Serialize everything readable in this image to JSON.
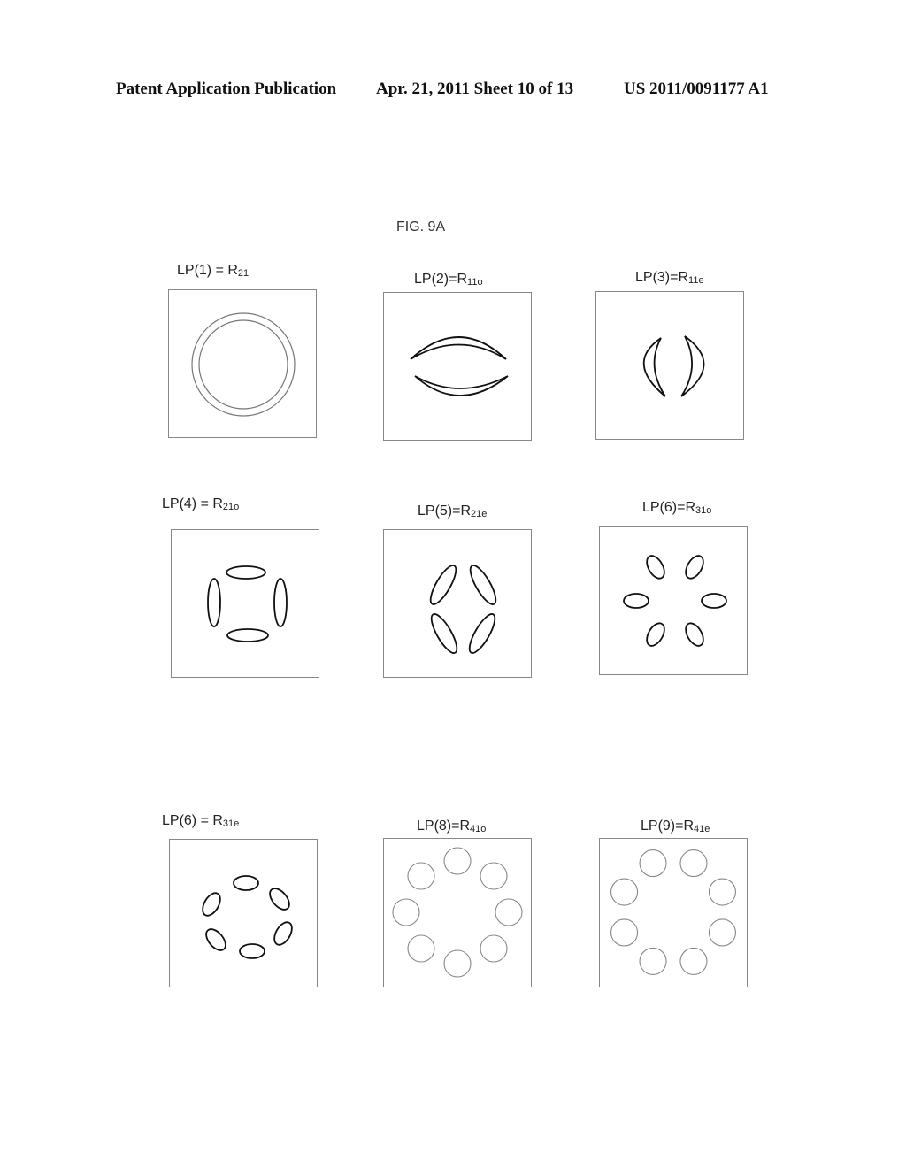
{
  "header": {
    "publication": "Patent Application Publication",
    "date_sheet": "Apr. 21, 2011  Sheet 10 of 13",
    "patent_number": "US 2011/0091177 A1"
  },
  "figure_title": "FIG. 9A",
  "panels": [
    {
      "label": "LP(1) = R",
      "sub": "21",
      "pattern": "concentric-rings"
    },
    {
      "label": "LP(2)=R",
      "sub": "11o",
      "pattern": "two-horizontal-crescents"
    },
    {
      "label": "LP(3)=R",
      "sub": "11e",
      "pattern": "two-vertical-crescents"
    },
    {
      "label": "LP(4) = R",
      "sub": "21o",
      "pattern": "four-ellipses-cross"
    },
    {
      "label": "LP(5)=R",
      "sub": "21e",
      "pattern": "four-ellipses-diagonal"
    },
    {
      "label": "LP(6)=R",
      "sub": "31o",
      "pattern": "six-ellipses-ring"
    },
    {
      "label": "LP(6) = R",
      "sub": "31e",
      "pattern": "six-ellipses-ring-rotated"
    },
    {
      "label": "LP(8)=R",
      "sub": "41o",
      "pattern": "eight-circles-ring"
    },
    {
      "label": "LP(9)=R",
      "sub": "41e",
      "pattern": "eight-circles-ring-rotated"
    }
  ]
}
